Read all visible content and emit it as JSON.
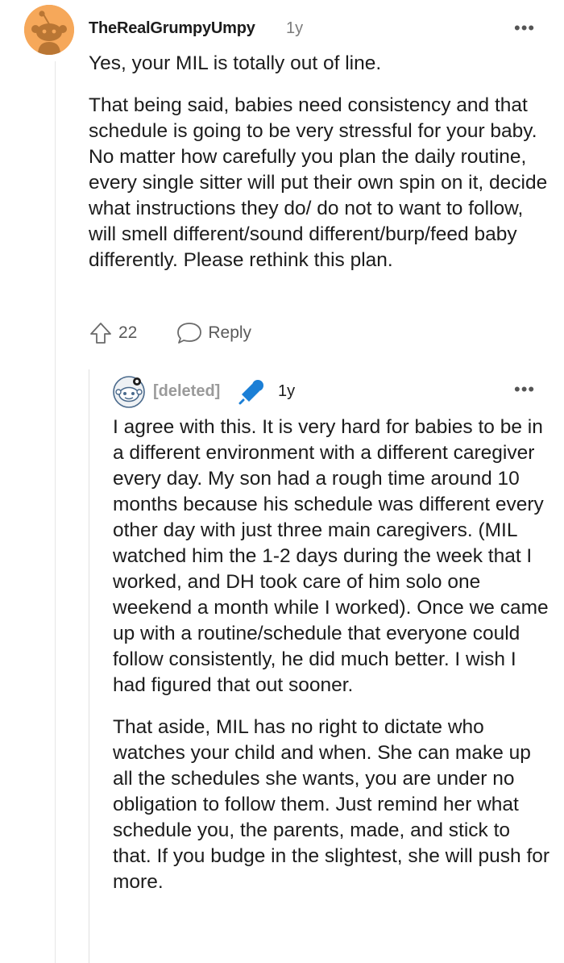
{
  "comment": {
    "author": "TheRealGrumpyUmpy",
    "age": "1y",
    "more_options": "•••",
    "paragraphs": [
      "Yes, your MIL is totally out of line.",
      "That being said, babies need consistency and that schedule is going to be very stressful for your baby. No matter how carefully you plan the daily routine, every single sitter will put their own spin on it, decide what instructions they do/ do not to want to follow, will smell different/sound different/burp/feed baby differently. Please rethink this plan."
    ],
    "vote_count": "22",
    "reply_label": "Reply",
    "avatar_color": "#f6a85a"
  },
  "reply": {
    "author": "[deleted]",
    "age": "1y",
    "more_options": "•••",
    "badge_color": "#1b7fd6",
    "paragraphs": [
      "I agree with this. It is very hard for babies to be in a different environment with a different caregiver every day. My son had a rough time around 10 months because his schedule was different every other day with just three main caregivers. (MIL watched him the 1-2 days during the week that I worked, and DH took care of him solo one weekend a month while I worked). Once we came up with a routine/schedule that everyone could follow consistently, he did much better. I wish I had figured that out sooner.",
      "That aside, MIL has no right to dictate who watches your child and when. She can make up all the schedules she wants, you are under no obligation to follow them. Just remind her what schedule you, the parents, made, and stick to that. If you budge in the slightest, she will push for more."
    ]
  }
}
